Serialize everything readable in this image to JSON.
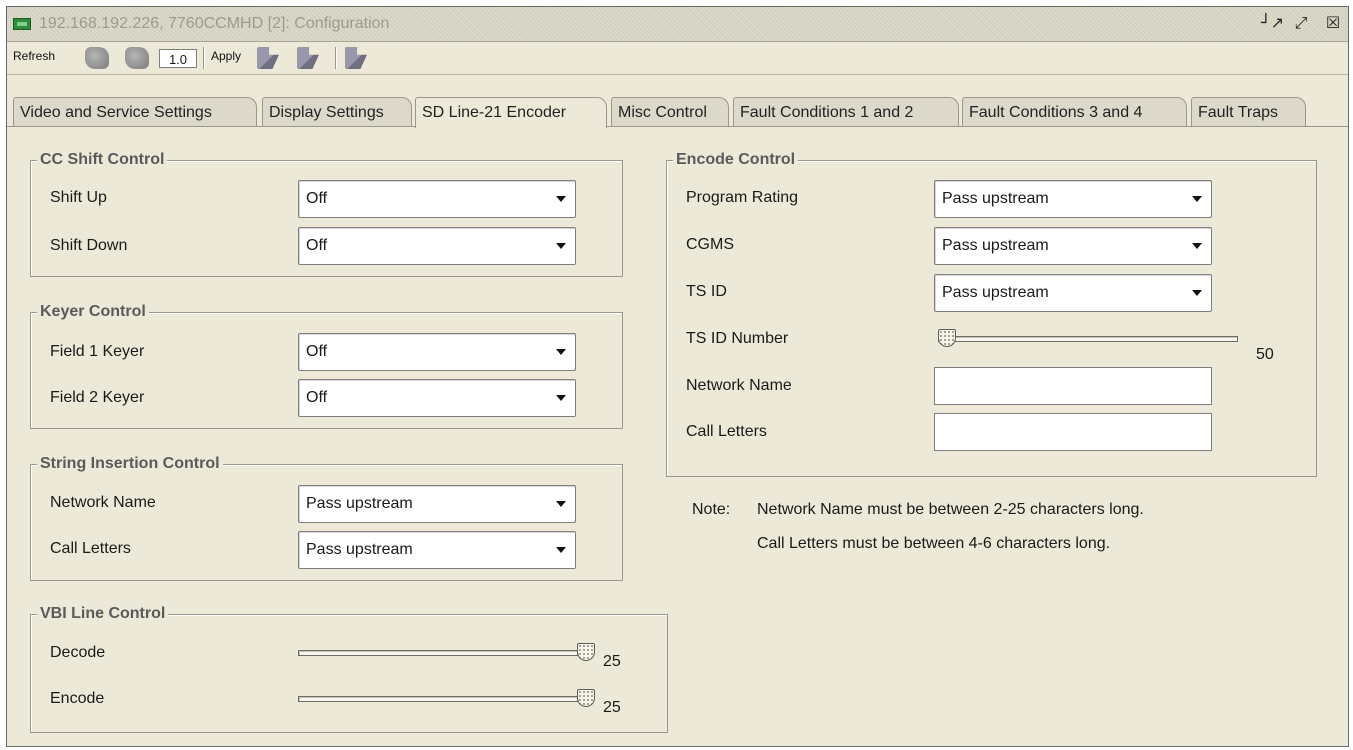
{
  "window": {
    "title": "192.168.192.226, 7760CCMHD  [2]: Configuration",
    "controls": [
      "┘↗",
      "⤢",
      "☒"
    ]
  },
  "toolbar": {
    "refresh_label": "Refresh",
    "version": "1.0",
    "apply_label": "Apply"
  },
  "tabs": [
    "Video and Service Settings",
    "Display Settings",
    "SD Line-21 Encoder",
    "Misc Control",
    "Fault Conditions 1 and 2",
    "Fault Conditions 3 and 4",
    "Fault Traps"
  ],
  "active_tab": "SD Line-21 Encoder",
  "cc_shift": {
    "title": "CC Shift Control",
    "shift_up": {
      "label": "Shift Up",
      "value": "Off"
    },
    "shift_down": {
      "label": "Shift Down",
      "value": "Off"
    }
  },
  "keyer": {
    "title": "Keyer Control",
    "field1": {
      "label": "Field 1 Keyer",
      "value": "Off"
    },
    "field2": {
      "label": "Field 2 Keyer",
      "value": "Off"
    }
  },
  "string_insertion": {
    "title": "String Insertion Control",
    "network_name": {
      "label": "Network Name",
      "value": "Pass upstream"
    },
    "call_letters": {
      "label": "Call Letters",
      "value": "Pass upstream"
    }
  },
  "vbi": {
    "title": "VBI Line Control",
    "decode": {
      "label": "Decode",
      "value": "25"
    },
    "encode": {
      "label": "Encode",
      "value": "25"
    }
  },
  "encode_control": {
    "title": "Encode Control",
    "program_rating": {
      "label": "Program Rating",
      "value": "Pass upstream"
    },
    "cgms": {
      "label": "CGMS",
      "value": "Pass upstream"
    },
    "ts_id": {
      "label": "TS ID",
      "value": "Pass upstream"
    },
    "ts_id_number": {
      "label": "TS ID Number",
      "value": "50"
    },
    "network_name": {
      "label": "Network Name",
      "value": ""
    },
    "call_letters": {
      "label": "Call Letters",
      "value": ""
    }
  },
  "note": {
    "prefix": "Note:",
    "line1": "Network Name must be between 2-25 characters long.",
    "line2": "Call Letters must be between 4-6 characters long."
  }
}
